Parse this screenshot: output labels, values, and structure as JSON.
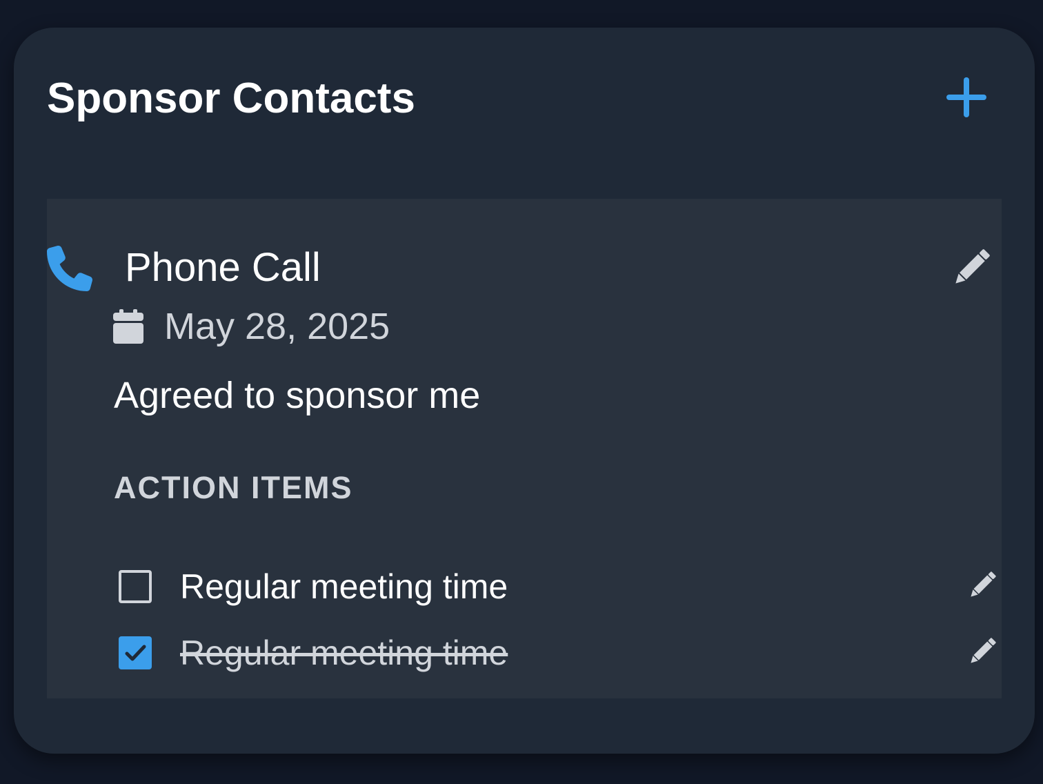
{
  "card": {
    "title": "Sponsor Contacts",
    "add_icon": "plus-icon"
  },
  "contact": {
    "type": "Phone Call",
    "type_icon": "phone-icon",
    "date": "May 28, 2025",
    "date_icon": "calendar-icon",
    "notes": "Agreed to sponsor me",
    "edit_icon": "pencil-icon",
    "action_items_heading": "ACTION ITEMS",
    "action_items": [
      {
        "text": "Regular meeting time",
        "completed": false
      },
      {
        "text": "Regular meeting time",
        "completed": true
      }
    ]
  },
  "colors": {
    "page_background": "#111827",
    "card_background": "#1f2937",
    "panel_background": "#29323e",
    "accent": "#3b9eeb",
    "text_primary": "#ffffff",
    "text_secondary": "#d1d5db"
  }
}
